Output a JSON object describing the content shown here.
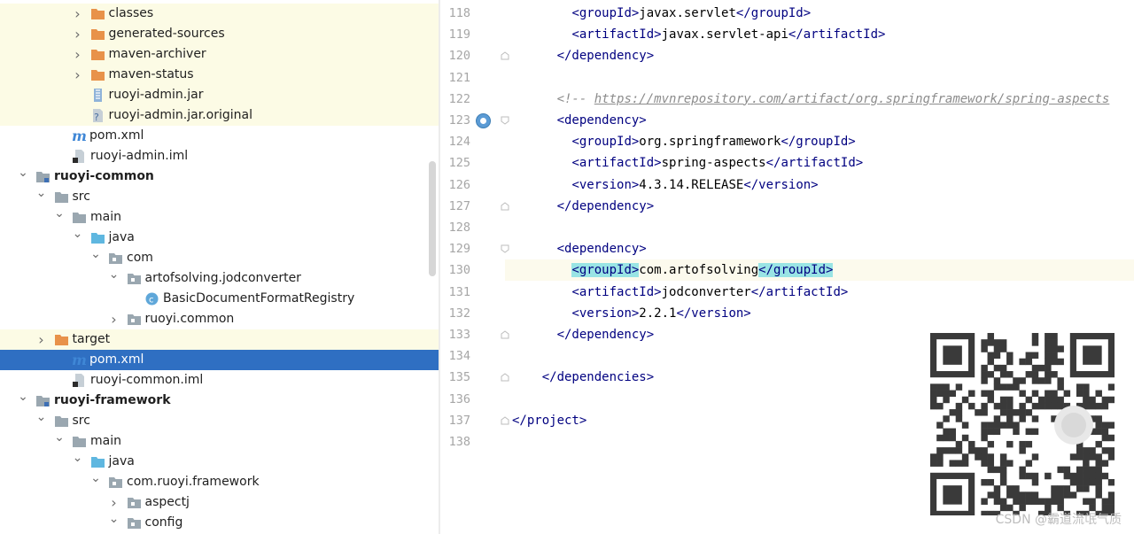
{
  "tree": {
    "rows": [
      {
        "label": "classes",
        "kind": "folder-orange",
        "expand": "collapsed",
        "depth": 4,
        "hl": true
      },
      {
        "label": "generated-sources",
        "kind": "folder-orange",
        "expand": "collapsed",
        "depth": 4,
        "hl": true
      },
      {
        "label": "maven-archiver",
        "kind": "folder-orange",
        "expand": "collapsed",
        "depth": 4,
        "hl": true
      },
      {
        "label": "maven-status",
        "kind": "folder-orange",
        "expand": "collapsed",
        "depth": 4,
        "hl": true
      },
      {
        "label": "ruoyi-admin.jar",
        "kind": "jar",
        "expand": "none",
        "depth": 4,
        "hl": true
      },
      {
        "label": "ruoyi-admin.jar.original",
        "kind": "unknown",
        "expand": "none",
        "depth": 4,
        "hl": true
      },
      {
        "label": "pom.xml",
        "kind": "maven",
        "expand": "none",
        "depth": 3,
        "hl": false
      },
      {
        "label": "ruoyi-admin.iml",
        "kind": "iml",
        "expand": "none",
        "depth": 3,
        "hl": false
      },
      {
        "label": "ruoyi-common",
        "kind": "module",
        "expand": "expanded",
        "depth": 1,
        "hl": false,
        "bold": true
      },
      {
        "label": "src",
        "kind": "folder-gray",
        "expand": "expanded",
        "depth": 2,
        "hl": false
      },
      {
        "label": "main",
        "kind": "folder-gray",
        "expand": "expanded",
        "depth": 3,
        "hl": false
      },
      {
        "label": "java",
        "kind": "folder-blue",
        "expand": "expanded",
        "depth": 4,
        "hl": false
      },
      {
        "label": "com",
        "kind": "package",
        "expand": "expanded",
        "depth": 5,
        "hl": false
      },
      {
        "label": "artofsolving.jodconverter",
        "kind": "package",
        "expand": "expanded",
        "depth": 6,
        "hl": false
      },
      {
        "label": "BasicDocumentFormatRegistry",
        "kind": "class",
        "expand": "none",
        "depth": 7,
        "hl": false
      },
      {
        "label": "ruoyi.common",
        "kind": "package",
        "expand": "collapsed",
        "depth": 6,
        "hl": false
      },
      {
        "label": "target",
        "kind": "folder-orange",
        "expand": "collapsed",
        "depth": 2,
        "hl": true
      },
      {
        "label": "pom.xml",
        "kind": "maven",
        "expand": "none",
        "depth": 3,
        "hl": false,
        "selected": true
      },
      {
        "label": "ruoyi-common.iml",
        "kind": "iml",
        "expand": "none",
        "depth": 3,
        "hl": false
      },
      {
        "label": "ruoyi-framework",
        "kind": "module",
        "expand": "expanded",
        "depth": 1,
        "hl": false,
        "bold": true
      },
      {
        "label": "src",
        "kind": "folder-gray",
        "expand": "expanded",
        "depth": 2,
        "hl": false
      },
      {
        "label": "main",
        "kind": "folder-gray",
        "expand": "expanded",
        "depth": 3,
        "hl": false
      },
      {
        "label": "java",
        "kind": "folder-blue",
        "expand": "expanded",
        "depth": 4,
        "hl": false
      },
      {
        "label": "com.ruoyi.framework",
        "kind": "package",
        "expand": "expanded",
        "depth": 5,
        "hl": false
      },
      {
        "label": "aspectj",
        "kind": "package",
        "expand": "collapsed",
        "depth": 6,
        "hl": false
      },
      {
        "label": "config",
        "kind": "package",
        "expand": "expanded",
        "depth": 6,
        "hl": false
      }
    ]
  },
  "editor": {
    "lines": [
      {
        "num": "118",
        "indent": 8,
        "parts": [
          [
            "tg",
            "<groupId>"
          ],
          [
            "tx",
            "javax.servlet"
          ],
          [
            "tg",
            "</groupId>"
          ]
        ]
      },
      {
        "num": "119",
        "indent": 8,
        "parts": [
          [
            "tg",
            "<artifactId>"
          ],
          [
            "tx",
            "javax.servlet-api"
          ],
          [
            "tg",
            "</artifactId>"
          ]
        ]
      },
      {
        "num": "120",
        "indent": 6,
        "parts": [
          [
            "tg",
            "</dependency>"
          ]
        ],
        "fold": "end"
      },
      {
        "num": "121",
        "indent": 0,
        "parts": []
      },
      {
        "num": "122",
        "indent": 6,
        "parts": [
          [
            "cm",
            "<!-- "
          ],
          [
            "lk",
            "https://mvnrepository.com/artifact/org.springframework/spring-aspects"
          ]
        ]
      },
      {
        "num": "123",
        "indent": 6,
        "parts": [
          [
            "tg",
            "<dependency>"
          ]
        ],
        "fold": "start",
        "bean": true
      },
      {
        "num": "124",
        "indent": 8,
        "parts": [
          [
            "tg",
            "<groupId>"
          ],
          [
            "tx",
            "org.springframework"
          ],
          [
            "tg",
            "</groupId>"
          ]
        ]
      },
      {
        "num": "125",
        "indent": 8,
        "parts": [
          [
            "tg",
            "<artifactId>"
          ],
          [
            "tx",
            "spring-aspects"
          ],
          [
            "tg",
            "</artifactId>"
          ]
        ]
      },
      {
        "num": "126",
        "indent": 8,
        "parts": [
          [
            "tg",
            "<version>"
          ],
          [
            "tx",
            "4.3.14.RELEASE"
          ],
          [
            "tg",
            "</version>"
          ]
        ]
      },
      {
        "num": "127",
        "indent": 6,
        "parts": [
          [
            "tg",
            "</dependency>"
          ]
        ],
        "fold": "end"
      },
      {
        "num": "128",
        "indent": 0,
        "parts": []
      },
      {
        "num": "129",
        "indent": 6,
        "parts": [
          [
            "tg",
            "<dependency>"
          ]
        ],
        "fold": "start"
      },
      {
        "num": "130",
        "indent": 8,
        "parts": [
          [
            "tgh",
            "<groupId>"
          ],
          [
            "tx",
            "com.artofsolving"
          ],
          [
            "tgh",
            "</groupId>"
          ]
        ],
        "current": true
      },
      {
        "num": "131",
        "indent": 8,
        "parts": [
          [
            "tg",
            "<artifactId>"
          ],
          [
            "tx",
            "jodconverter"
          ],
          [
            "tg",
            "</artifactId>"
          ]
        ]
      },
      {
        "num": "132",
        "indent": 8,
        "parts": [
          [
            "tg",
            "<version>"
          ],
          [
            "tx",
            "2.2.1"
          ],
          [
            "tg",
            "</version>"
          ]
        ]
      },
      {
        "num": "133",
        "indent": 6,
        "parts": [
          [
            "tg",
            "</dependency>"
          ]
        ],
        "fold": "end"
      },
      {
        "num": "134",
        "indent": 0,
        "parts": []
      },
      {
        "num": "135",
        "indent": 4,
        "parts": [
          [
            "tg",
            "</dependencies>"
          ]
        ],
        "fold": "end"
      },
      {
        "num": "136",
        "indent": 0,
        "parts": []
      },
      {
        "num": "137",
        "indent": 0,
        "parts": [
          [
            "tg",
            "</project>"
          ]
        ],
        "fold": "end"
      },
      {
        "num": "138",
        "indent": 0,
        "parts": []
      }
    ]
  },
  "watermark": "CSDN @霸道流氓气质",
  "colors": {
    "tag": "#000080",
    "selection": "#2f6fc2",
    "excluded_bg": "#fcfbe5",
    "current_line": "#fcfaed",
    "tag_match": "#99e4e4"
  }
}
